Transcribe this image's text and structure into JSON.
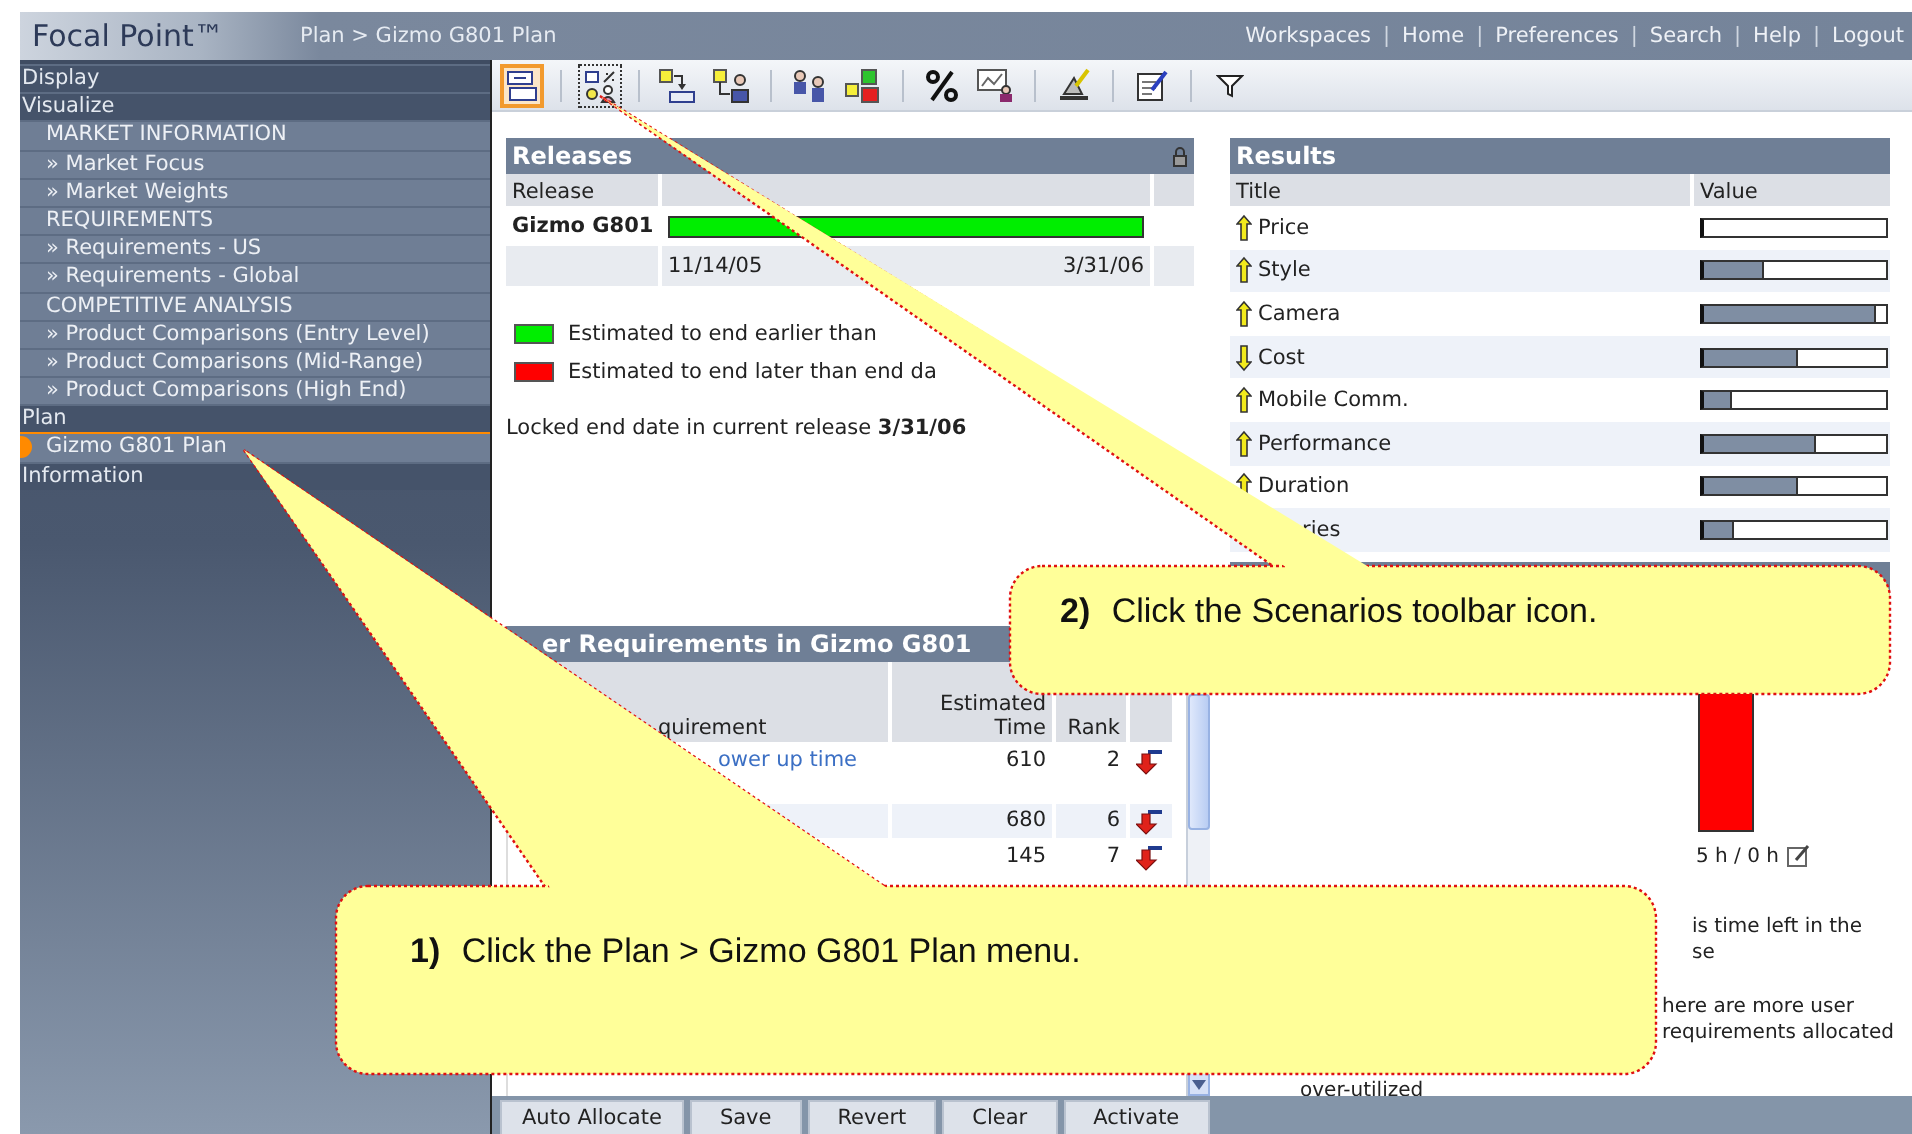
{
  "header": {
    "logo": "Focal Point™",
    "breadcrumb": "Plan > Gizmo G801 Plan",
    "links": [
      "Workspaces",
      "Home",
      "Preferences",
      "Search",
      "Help",
      "Logout"
    ],
    "separator": "|"
  },
  "sidebar": {
    "items": [
      {
        "label": "Display",
        "selected": false
      },
      {
        "label": "Visualize",
        "selected": false,
        "children": [
          {
            "label": "MARKET INFORMATION",
            "selected": false,
            "children": [
              {
                "label": "» Market Focus",
                "selected": false
              },
              {
                "label": "» Market Weights",
                "selected": false
              }
            ]
          },
          {
            "label": "REQUIREMENTS",
            "selected": false,
            "children": [
              {
                "label": "» Requirements - US",
                "selected": false
              },
              {
                "label": "» Requirements - Global",
                "selected": false
              }
            ]
          },
          {
            "label": "COMPETITIVE ANALYSIS",
            "selected": false,
            "children": [
              {
                "label": "» Product Comparisons (Entry Level)",
                "selected": false
              },
              {
                "label": "» Product Comparisons (Mid-Range)",
                "selected": false
              },
              {
                "label": "» Product Comparisons (High End)",
                "selected": false
              }
            ]
          }
        ]
      },
      {
        "label": "Plan",
        "selected": false,
        "children": [
          {
            "label": "Gizmo G801 Plan",
            "selected": true
          }
        ]
      },
      {
        "label": "Information",
        "selected": false
      }
    ]
  },
  "toolbar": [
    {
      "kind": "layout",
      "selected": true
    },
    {
      "kind": "separator"
    },
    {
      "kind": "scenarios",
      "selected": false,
      "focused": true
    },
    {
      "kind": "separator"
    },
    {
      "kind": "link-down",
      "selected": false
    },
    {
      "kind": "link-user",
      "selected": false
    },
    {
      "kind": "separator"
    },
    {
      "kind": "users",
      "selected": false
    },
    {
      "kind": "blocks",
      "selected": false
    },
    {
      "kind": "separator"
    },
    {
      "kind": "percent",
      "selected": false
    },
    {
      "kind": "chart-user",
      "selected": false
    },
    {
      "kind": "separator"
    },
    {
      "kind": "wizard",
      "selected": false
    },
    {
      "kind": "separator"
    },
    {
      "kind": "notes",
      "selected": false
    },
    {
      "kind": "separator"
    },
    {
      "kind": "filter",
      "selected": false
    }
  ],
  "releases": {
    "title": "Releases",
    "column": "Release",
    "rows": [
      {
        "name": "Gizmo G801",
        "color": "#00ee00",
        "start": "11/14/05",
        "end": "3/31/06"
      }
    ],
    "legend": [
      {
        "color": "#00ee00",
        "label": "Estimated to end earlier than"
      },
      {
        "color": "#ff0000",
        "label": "Estimated to end later than end da"
      }
    ],
    "locked": "Locked end date in current release **3/31/06**"
  },
  "results": {
    "title": "Results",
    "columns": [
      "Title",
      "Value"
    ],
    "rows": [
      {
        "title": "Price",
        "kind": "up",
        "level": 0.0
      },
      {
        "title": "Style",
        "kind": "up",
        "level": 0.33
      },
      {
        "title": "Camera",
        "kind": "up",
        "level": 0.95
      },
      {
        "title": "Cost",
        "kind": "down",
        "level": 0.52
      },
      {
        "title": "Mobile Comm.",
        "kind": "up",
        "level": 0.15
      },
      {
        "title": "Performance",
        "kind": "up",
        "level": 0.61
      },
      {
        "title": "Duration",
        "kind": "up",
        "level": 0.52
      },
      {
        "title": "ries",
        "kind": "partial",
        "level": 0.17
      }
    ]
  },
  "user_requirements": {
    "title": "er Requirements in Gizmo G801",
    "columns": [
      "quirement",
      "Estimated Time",
      "Rank"
    ],
    "rows": [
      {
        "requirement": "ower up time",
        "time": "610",
        "rank": "2"
      },
      {
        "time": "680",
        "rank": "6"
      },
      {
        "time": "145",
        "rank": "7"
      }
    ]
  },
  "capacity": {
    "reading": "5 h / 0 h",
    "notes": [
      {
        "lines": [
          "is time left in the",
          "se"
        ]
      },
      {
        "lines": [
          "here are more user",
          "requirements allocated"
        ]
      }
    ],
    "over_label": "over-utilized"
  },
  "buttons": [
    "Auto Allocate",
    "Save",
    "Revert",
    "Clear",
    "Activate"
  ],
  "callouts": [
    {
      "step": "**2)** Click the Scenarios toolbar icon."
    },
    {
      "step": "**1)** Click the Plan > Gizmo G801 Plan menu."
    }
  ]
}
